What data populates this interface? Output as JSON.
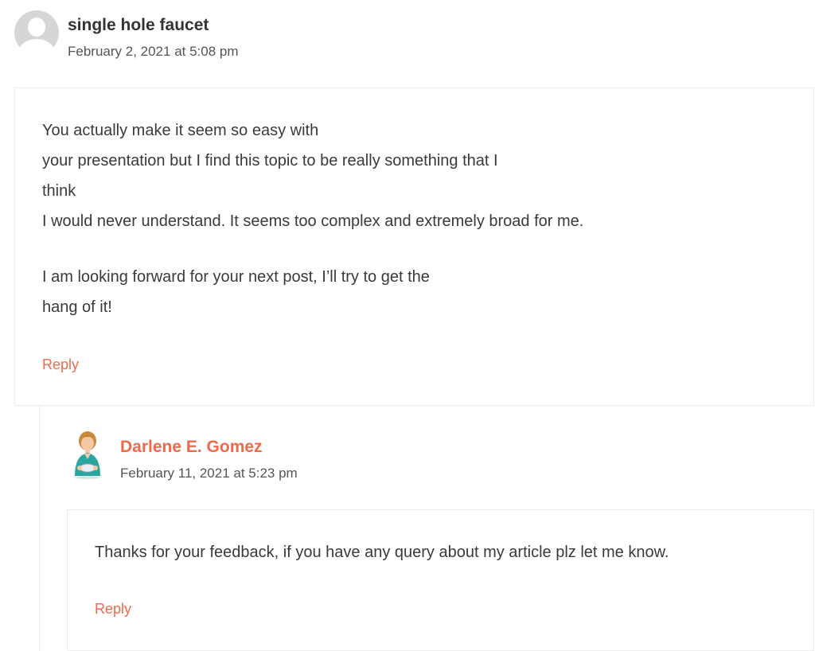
{
  "comments": [
    {
      "author": "single hole faucet",
      "date": "February 2, 2021 at 5:08 pm",
      "lines": [
        "You actually make it seem so easy with",
        "your presentation but I find this topic to be really something that I",
        "think",
        "I would never understand. It seems too complex and extremely broad for me.",
        "",
        "I am looking forward for your next post, I’ll try to get the",
        "hang of it!"
      ],
      "reply_label": "Reply",
      "author_color": "#333333"
    },
    {
      "author": "Darlene E. Gomez",
      "date": "February 11, 2021 at 5:23 pm",
      "lines": [
        "Thanks for your feedback, if you have any query about my article plz let me know."
      ],
      "reply_label": "Reply",
      "author_color": "#ee6a4c"
    }
  ],
  "icons": {
    "default_avatar": "default-user-avatar-icon",
    "author_avatar": "nurse-avatar-illustration"
  },
  "colors": {
    "accent": "#ee6a4c",
    "border": "#ececec"
  }
}
